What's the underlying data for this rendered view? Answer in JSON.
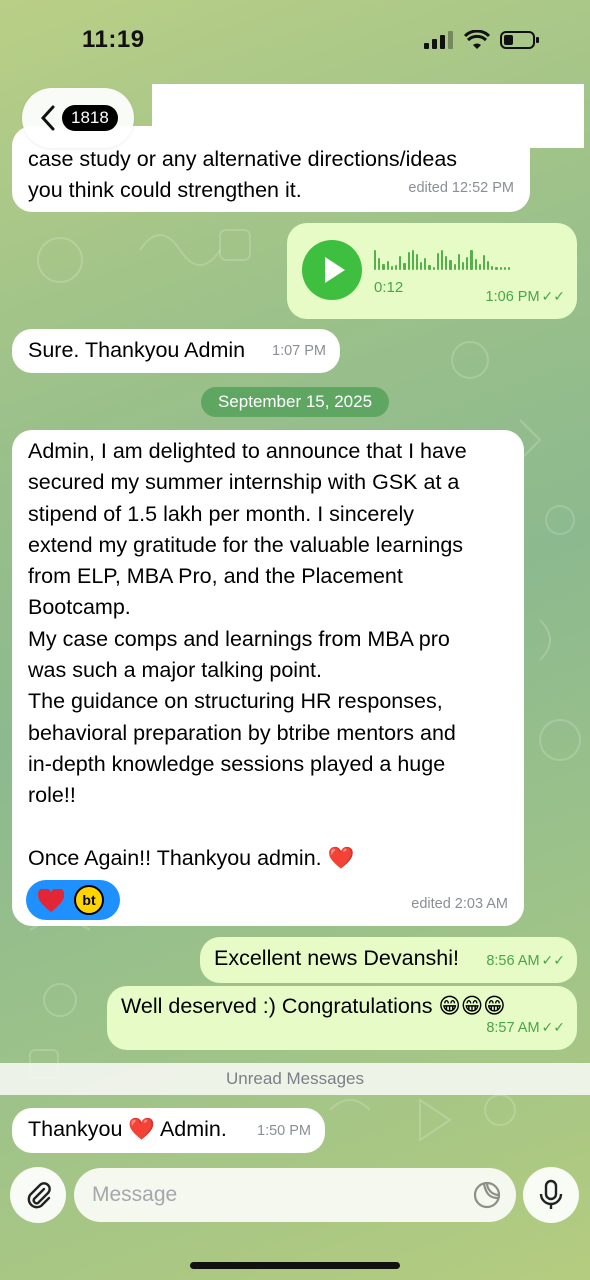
{
  "status_bar": {
    "time": "11:19"
  },
  "header": {
    "unread_count": "1818"
  },
  "messages": {
    "m1": {
      "line1": "case study or any alternative directions/ideas",
      "line2": "you think could strengthen it.",
      "time": "edited 12:52 PM"
    },
    "voice": {
      "duration": "0:12",
      "time": "1:06 PM"
    },
    "m2": {
      "text": "Sure. Thankyou Admin",
      "time": "1:07 PM"
    },
    "date_separator": "September 15, 2025",
    "m3": {
      "lines": [
        "Admin, I am delighted to announce that I have",
        "secured my summer internship with GSK at a",
        "stipend of 1.5 lakh per month. I sincerely",
        "extend my gratitude for the valuable learnings",
        "from ELP, MBA Pro, and the Placement",
        "Bootcamp.",
        "My case comps and learnings from MBA pro",
        "was such a major talking point.",
        "The guidance on structuring HR responses,",
        "behavioral preparation by btribe mentors and",
        "in-depth knowledge sessions played a huge",
        "role!!",
        "",
        "Once Again!! Thankyou admin. ❤️"
      ],
      "reaction_label": "bt",
      "time": "edited 2:03 AM"
    },
    "m4": {
      "text": "Excellent news Devanshi!",
      "time": "8:56 AM"
    },
    "m5": {
      "text": "Well deserved :) Congratulations 😁😁😁",
      "time": "8:57 AM"
    },
    "unread_separator": "Unread Messages",
    "m6": {
      "text": "Thankyou ❤️ Admin.",
      "time": "1:50 PM"
    }
  },
  "composer": {
    "placeholder": "Message"
  },
  "colors": {
    "out_bubble": "#e6fbc6",
    "accent_green": "#4aa54a",
    "date_pill": "#5fa662"
  }
}
